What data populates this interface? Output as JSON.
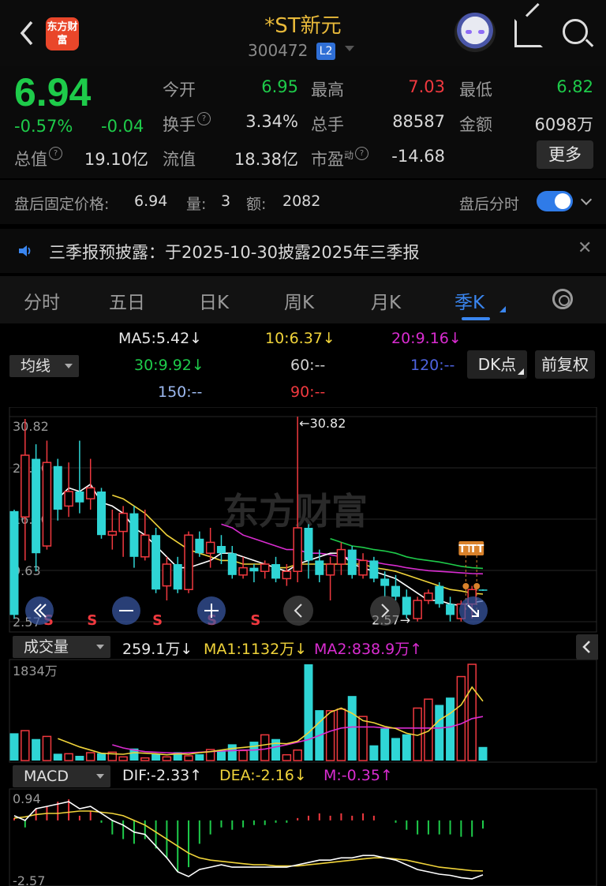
{
  "header": {
    "back_icon": "chevron-left-icon",
    "logo_text": "东方财富",
    "title": "*ST新元",
    "code": "300472",
    "level_badge": "L2"
  },
  "quote": {
    "price": "6.94",
    "change_pct": "-0.57%",
    "change_abs": "-0.04",
    "labels": {
      "open": "今开",
      "high": "最高",
      "low": "最低",
      "turnover": "换手",
      "volume": "总手",
      "amount": "金额",
      "mktcap": "总值",
      "float_cap": "流值",
      "pe": "市盈"
    },
    "pe_sup": "动",
    "values": {
      "open": "6.95",
      "high": "7.03",
      "low": "6.82",
      "turnover": "3.34%",
      "volume": "88587",
      "amount": "6098万",
      "mktcap": "19.10亿",
      "float_cap": "18.38亿",
      "pe": "-14.68"
    },
    "more_label": "更多"
  },
  "after_hours": {
    "price_label": "盘后固定价格:",
    "price": "6.94",
    "vol_label": "量:",
    "vol": "3",
    "amt_label": "额:",
    "amt": "2082",
    "timeshare_label": "盘后分时",
    "toggle_on": true
  },
  "notice": {
    "text": "三季报预披露：于2025-10-30披露2025年三季报"
  },
  "tabs": [
    "分时",
    "五日",
    "日K",
    "周K",
    "月K",
    "季K"
  ],
  "active_tab": "季K",
  "ma_legend": {
    "selector": "均线",
    "ma5": "MA5:5.42↓",
    "ma10": "10:6.37↓",
    "ma20": "20:9.16↓",
    "ma30": "30:9.92↓",
    "ma60": "60:--",
    "ma120": "120:--",
    "ma150": "150:--",
    "ma90": "90:--",
    "dk_button": "DK点",
    "adjust_button": "前复权"
  },
  "colors": {
    "up": "#f0393f",
    "down": "#2fd5d5",
    "ma5": "#ffffff",
    "ma10": "#f0d33a",
    "ma20": "#d92cd0",
    "ma30": "#1ecb4a",
    "ma120": "#4e63e0",
    "ma150": "#9db9f0"
  },
  "chart_data": {
    "type": "candlestick",
    "y_ticks": [
      "30.82",
      "23.76",
      "16.70",
      "9.63",
      "2.57"
    ],
    "ylim": [
      2.57,
      30.82
    ],
    "max_label": "←30.82",
    "min_label": "2.57→",
    "watermark": "东方财富",
    "signal_letters": [
      "S",
      "S",
      "S",
      "S",
      "S",
      "S"
    ],
    "markers": [
      "TT",
      "TT"
    ],
    "candles": [
      {
        "o": 17.8,
        "c": 3.5,
        "h": 18.0,
        "l": 3.0
      },
      {
        "o": 17.0,
        "c": 25.5,
        "h": 30.5,
        "l": 11.0
      },
      {
        "o": 25.0,
        "c": 12.0,
        "h": 27.0,
        "l": 9.5
      },
      {
        "o": 13.0,
        "c": 24.5,
        "h": 27.5,
        "l": 12.5
      },
      {
        "o": 24.0,
        "c": 18.0,
        "h": 25.0,
        "l": 16.5
      },
      {
        "o": 18.5,
        "c": 20.5,
        "h": 24.5,
        "l": 17.0
      },
      {
        "o": 20.5,
        "c": 19.0,
        "h": 27.5,
        "l": 17.5
      },
      {
        "o": 19.5,
        "c": 21.0,
        "h": 25.0,
        "l": 18.0
      },
      {
        "o": 20.5,
        "c": 14.5,
        "h": 21.0,
        "l": 14.0
      },
      {
        "o": 14.5,
        "c": 15.0,
        "h": 18.0,
        "l": 12.5
      },
      {
        "o": 15.0,
        "c": 17.5,
        "h": 18.5,
        "l": 11.5
      },
      {
        "o": 17.5,
        "c": 11.5,
        "h": 18.5,
        "l": 10.0
      },
      {
        "o": 11.5,
        "c": 14.5,
        "h": 18.0,
        "l": 11.0
      },
      {
        "o": 14.5,
        "c": 7.0,
        "h": 15.5,
        "l": 6.5
      },
      {
        "o": 7.5,
        "c": 10.5,
        "h": 11.5,
        "l": 5.5
      },
      {
        "o": 10.5,
        "c": 7.0,
        "h": 11.5,
        "l": 6.5
      },
      {
        "o": 7.0,
        "c": 14.5,
        "h": 15.0,
        "l": 6.5
      },
      {
        "o": 14.0,
        "c": 12.0,
        "h": 15.0,
        "l": 11.5
      },
      {
        "o": 12.0,
        "c": 13.5,
        "h": 15.5,
        "l": 10.0
      },
      {
        "o": 13.0,
        "c": 12.0,
        "h": 14.5,
        "l": 10.5
      },
      {
        "o": 12.0,
        "c": 9.0,
        "h": 13.0,
        "l": 8.5
      },
      {
        "o": 9.0,
        "c": 10.0,
        "h": 11.5,
        "l": 8.5
      },
      {
        "o": 10.0,
        "c": 9.5,
        "h": 10.5,
        "l": 8.0
      },
      {
        "o": 9.5,
        "c": 10.5,
        "h": 11.0,
        "l": 8.5
      },
      {
        "o": 10.5,
        "c": 8.5,
        "h": 11.5,
        "l": 8.0
      },
      {
        "o": 8.5,
        "c": 9.5,
        "h": 10.5,
        "l": 7.5
      },
      {
        "o": 9.5,
        "c": 15.5,
        "h": 30.8,
        "l": 8.0
      },
      {
        "o": 15.5,
        "c": 11.0,
        "h": 16.0,
        "l": 8.5
      },
      {
        "o": 11.0,
        "c": 9.0,
        "h": 12.5,
        "l": 8.0
      },
      {
        "o": 9.0,
        "c": 10.5,
        "h": 11.5,
        "l": 5.5
      },
      {
        "o": 10.5,
        "c": 12.5,
        "h": 13.5,
        "l": 9.0
      },
      {
        "o": 12.5,
        "c": 9.0,
        "h": 13.0,
        "l": 8.5
      },
      {
        "o": 9.0,
        "c": 11.0,
        "h": 12.0,
        "l": 8.5
      },
      {
        "o": 11.0,
        "c": 8.5,
        "h": 11.5,
        "l": 8.0
      },
      {
        "o": 8.5,
        "c": 7.5,
        "h": 9.5,
        "l": 6.0
      },
      {
        "o": 7.5,
        "c": 6.0,
        "h": 9.0,
        "l": 5.5
      },
      {
        "o": 6.0,
        "c": 3.5,
        "h": 7.0,
        "l": 3.0
      },
      {
        "o": 3.0,
        "c": 5.5,
        "h": 6.0,
        "l": 2.6
      },
      {
        "o": 5.5,
        "c": 6.5,
        "h": 7.0,
        "l": 5.0
      },
      {
        "o": 7.5,
        "c": 5.0,
        "h": 8.0,
        "l": 4.5
      },
      {
        "o": 5.0,
        "c": 3.5,
        "h": 6.0,
        "l": 2.6
      },
      {
        "o": 3.0,
        "c": 5.0,
        "h": 5.5,
        "l": 2.6
      },
      {
        "o": 5.0,
        "c": 7.0,
        "h": 7.5,
        "l": 3.0
      },
      {
        "o": 7.0,
        "c": 6.9,
        "h": 7.03,
        "l": 6.82
      }
    ],
    "ma5": [
      null,
      null,
      null,
      null,
      19.5,
      21.0,
      20.5,
      21.5,
      19.0,
      18.5,
      17.5,
      15.5,
      14.5,
      13.0,
      11.5,
      10.0,
      10.0,
      10.5,
      11.0,
      12.0,
      12.0,
      11.5,
      11.0,
      10.5,
      10.0,
      9.5,
      10.5,
      11.0,
      11.5,
      12.0,
      12.0,
      10.5,
      10.0,
      9.5,
      9.0,
      8.5,
      7.5,
      6.5,
      5.5,
      5.5,
      5.0,
      4.8,
      5.2,
      5.42
    ],
    "ma10": [
      null,
      null,
      null,
      null,
      null,
      null,
      null,
      null,
      null,
      20.0,
      19.5,
      18.5,
      17.5,
      16.0,
      14.5,
      13.5,
      12.5,
      12.0,
      11.5,
      11.0,
      11.0,
      10.5,
      10.5,
      10.5,
      10.0,
      10.0,
      10.5,
      10.5,
      10.5,
      10.5,
      10.5,
      10.5,
      10.5,
      10.0,
      9.8,
      9.5,
      9.0,
      8.5,
      8.0,
      7.5,
      7.0,
      6.8,
      6.5,
      6.37
    ],
    "ma20": [
      null,
      null,
      null,
      null,
      null,
      null,
      null,
      null,
      null,
      null,
      null,
      null,
      null,
      null,
      null,
      null,
      null,
      null,
      null,
      16.0,
      15.5,
      14.5,
      14.0,
      13.5,
      13.0,
      12.5,
      12.5,
      12.0,
      12.0,
      11.8,
      11.5,
      11.3,
      11.0,
      10.8,
      10.5,
      10.3,
      10.0,
      9.8,
      9.6,
      9.5,
      9.4,
      9.3,
      9.2,
      9.16
    ],
    "ma30": [
      null,
      null,
      null,
      null,
      null,
      null,
      null,
      null,
      null,
      null,
      null,
      null,
      null,
      null,
      null,
      null,
      null,
      null,
      null,
      null,
      null,
      null,
      null,
      null,
      null,
      null,
      null,
      null,
      null,
      14.0,
      13.5,
      13.0,
      12.8,
      12.5,
      12.3,
      12.0,
      11.5,
      11.2,
      11.0,
      10.8,
      10.5,
      10.2,
      10.0,
      9.92
    ],
    "volume": {
      "max_label": "1834万",
      "legend": {
        "selector": "成交量",
        "vol": "259.1万↓",
        "ma1": "MA1:1132万↓",
        "ma2": "MA2:838.9万↑"
      },
      "bars": [
        520,
        570,
        410,
        460,
        130,
        130,
        90,
        150,
        140,
        160,
        70,
        230,
        50,
        120,
        70,
        160,
        90,
        120,
        210,
        200,
        310,
        190,
        360,
        490,
        410,
        110,
        200,
        1834,
        960,
        950,
        980,
        1230,
        840,
        290,
        610,
        430,
        500,
        1000,
        1170,
        1060,
        1200,
        1600,
        1834,
        259
      ],
      "ma1": [
        null,
        null,
        null,
        null,
        420,
        340,
        260,
        200,
        140,
        130,
        120,
        150,
        140,
        130,
        110,
        130,
        120,
        150,
        170,
        200,
        230,
        250,
        270,
        300,
        330,
        320,
        370,
        530,
        730,
        920,
        1000,
        900,
        760,
        720,
        650,
        610,
        520,
        480,
        560,
        770,
        900,
        1060,
        1400,
        1132
      ],
      "ma2": [
        null,
        null,
        null,
        null,
        null,
        null,
        null,
        null,
        null,
        300,
        240,
        200,
        170,
        160,
        150,
        140,
        150,
        160,
        170,
        180,
        190,
        200,
        200,
        220,
        260,
        300,
        350,
        400,
        480,
        560,
        620,
        640,
        640,
        640,
        620,
        620,
        620,
        620,
        620,
        620,
        640,
        700,
        800,
        838.9
      ]
    },
    "macd": {
      "ticks": [
        "0.94",
        "-2.57"
      ],
      "legend": {
        "selector": "MACD",
        "dif": "DIF:-2.33↑",
        "dea": "DEA:-2.16↓",
        "m": "M:-0.35↑"
      },
      "dif": [
        0.2,
        0.0,
        0.5,
        0.6,
        0.7,
        0.8,
        0.5,
        0.6,
        0.3,
        0.0,
        -0.2,
        -0.5,
        -0.6,
        -1.1,
        -1.6,
        -2.2,
        -2.4,
        -2.1,
        -2.0,
        -1.9,
        -2.0,
        -2.0,
        -2.0,
        -2.0,
        -2.0,
        -2.0,
        -1.9,
        -1.8,
        -1.7,
        -1.7,
        -1.6,
        -1.6,
        -1.5,
        -1.5,
        -1.6,
        -1.7,
        -1.9,
        -2.1,
        -2.2,
        -2.3,
        -2.35,
        -2.45,
        -2.5,
        -2.33
      ],
      "dea": [
        0.1,
        0.15,
        0.25,
        0.3,
        0.3,
        0.35,
        0.4,
        0.4,
        0.35,
        0.3,
        0.2,
        0.0,
        -0.2,
        -0.5,
        -0.8,
        -1.1,
        -1.4,
        -1.6,
        -1.7,
        -1.75,
        -1.8,
        -1.85,
        -1.9,
        -1.9,
        -1.95,
        -1.95,
        -1.95,
        -1.9,
        -1.85,
        -1.8,
        -1.75,
        -1.7,
        -1.65,
        -1.6,
        -1.6,
        -1.65,
        -1.7,
        -1.8,
        -1.9,
        -2.0,
        -2.05,
        -2.1,
        -2.15,
        -2.16
      ],
      "m": [
        0.1,
        -0.3,
        0.5,
        0.6,
        0.8,
        0.9,
        0.2,
        0.4,
        -0.1,
        -0.6,
        -0.8,
        -1.0,
        -0.8,
        -1.2,
        -1.6,
        -2.2,
        -2.0,
        -1.0,
        -0.6,
        -0.3,
        -0.4,
        -0.3,
        -0.2,
        -0.2,
        -0.1,
        -0.1,
        0.1,
        0.2,
        0.3,
        0.2,
        0.3,
        0.2,
        0.3,
        0.2,
        0.0,
        -0.1,
        -0.4,
        -0.6,
        -0.6,
        -0.6,
        -0.6,
        -0.7,
        -0.7,
        -0.35
      ]
    }
  },
  "chart_controls": {
    "first_icon": "double-chevron-left-icon",
    "zoom_out_icon": "minus-icon",
    "zoom_in_icon": "plus-icon",
    "prev_icon": "chevron-left-icon",
    "next_icon": "chevron-right-icon",
    "end_icon": "arrow-down-right-icon",
    "collapse_icon": "chevron-left-icon"
  }
}
